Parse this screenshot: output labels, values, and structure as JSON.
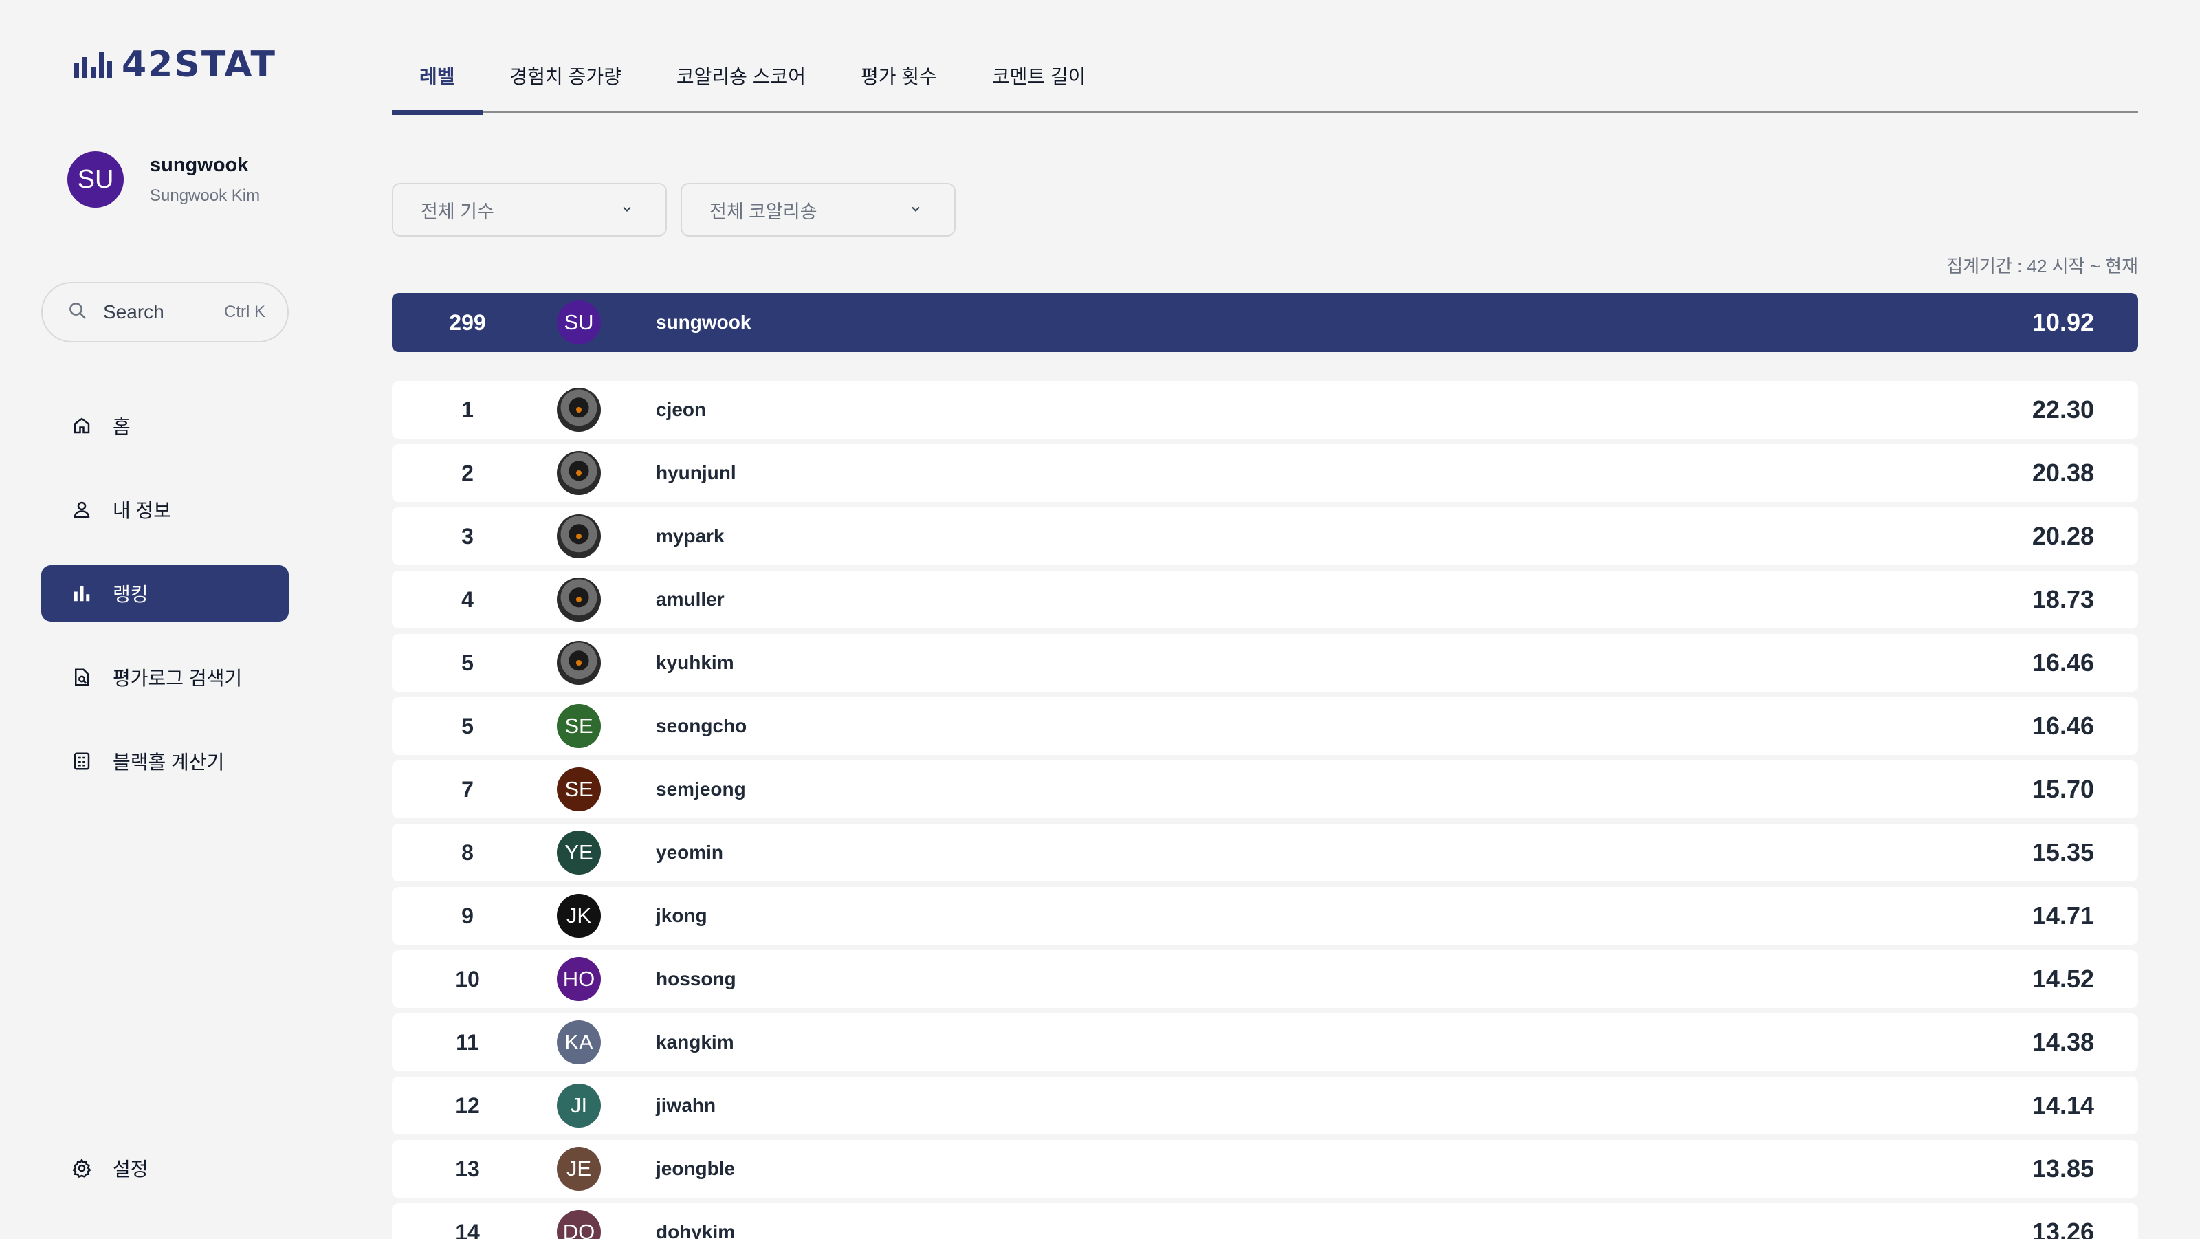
{
  "app": {
    "logo_text": "42STAT"
  },
  "profile": {
    "initials": "SU",
    "username": "sungwook",
    "full_name": "Sungwook Kim",
    "avatar_color": "#4c1d95"
  },
  "search": {
    "label": "Search",
    "shortcut": "Ctrl K"
  },
  "sidebar": {
    "items": [
      {
        "label": "홈",
        "icon": "home-icon",
        "active": false
      },
      {
        "label": "내 정보",
        "icon": "user-icon",
        "active": false
      },
      {
        "label": "랭킹",
        "icon": "bar-chart-icon",
        "active": true
      },
      {
        "label": "평가로그 검색기",
        "icon": "document-search-icon",
        "active": false
      },
      {
        "label": "블랙홀 계산기",
        "icon": "calculator-icon",
        "active": false
      }
    ],
    "settings_label": "설정"
  },
  "tabs": [
    {
      "label": "레벨",
      "active": true
    },
    {
      "label": "경험치 증가량",
      "active": false
    },
    {
      "label": "코알리숑 스코어",
      "active": false
    },
    {
      "label": "평가 횟수",
      "active": false
    },
    {
      "label": "코멘트 길이",
      "active": false
    }
  ],
  "filters": {
    "cohort": "전체 기수",
    "coalition": "전체 코알리숑"
  },
  "period": "집계기간 : 42 시작 ~ 현재",
  "me": {
    "rank": "299",
    "initials": "SU",
    "username": "sungwook",
    "score": "10.92",
    "color": "#4c1d95"
  },
  "rankings": [
    {
      "rank": "1",
      "username": "cjeon",
      "score": "22.30",
      "photo": true,
      "initials": ""
    },
    {
      "rank": "2",
      "username": "hyunjunl",
      "score": "20.38",
      "photo": true,
      "initials": ""
    },
    {
      "rank": "3",
      "username": "mypark",
      "score": "20.28",
      "photo": true,
      "initials": ""
    },
    {
      "rank": "4",
      "username": "amuller",
      "score": "18.73",
      "photo": true,
      "initials": ""
    },
    {
      "rank": "5",
      "username": "kyuhkim",
      "score": "16.46",
      "photo": true,
      "initials": ""
    },
    {
      "rank": "5",
      "username": "seongcho",
      "score": "16.46",
      "photo": false,
      "initials": "SE",
      "color": "#2f6b2f"
    },
    {
      "rank": "7",
      "username": "semjeong",
      "score": "15.70",
      "photo": false,
      "initials": "SE",
      "color": "#5a1f0b"
    },
    {
      "rank": "8",
      "username": "yeomin",
      "score": "15.35",
      "photo": false,
      "initials": "YE",
      "color": "#1f4a3d"
    },
    {
      "rank": "9",
      "username": "jkong",
      "score": "14.71",
      "photo": false,
      "initials": "JK",
      "color": "#111111"
    },
    {
      "rank": "10",
      "username": "hossong",
      "score": "14.52",
      "photo": false,
      "initials": "HO",
      "color": "#5b1a8a"
    },
    {
      "rank": "11",
      "username": "kangkim",
      "score": "14.38",
      "photo": false,
      "initials": "KA",
      "color": "#5f6b86"
    },
    {
      "rank": "12",
      "username": "jiwahn",
      "score": "14.14",
      "photo": false,
      "initials": "JI",
      "color": "#2f6b63"
    },
    {
      "rank": "13",
      "username": "jeongble",
      "score": "13.85",
      "photo": false,
      "initials": "JE",
      "color": "#6b4a3a"
    },
    {
      "rank": "14",
      "username": "dohykim",
      "score": "13.26",
      "photo": false,
      "initials": "DO",
      "color": "#6b3a4a"
    }
  ]
}
